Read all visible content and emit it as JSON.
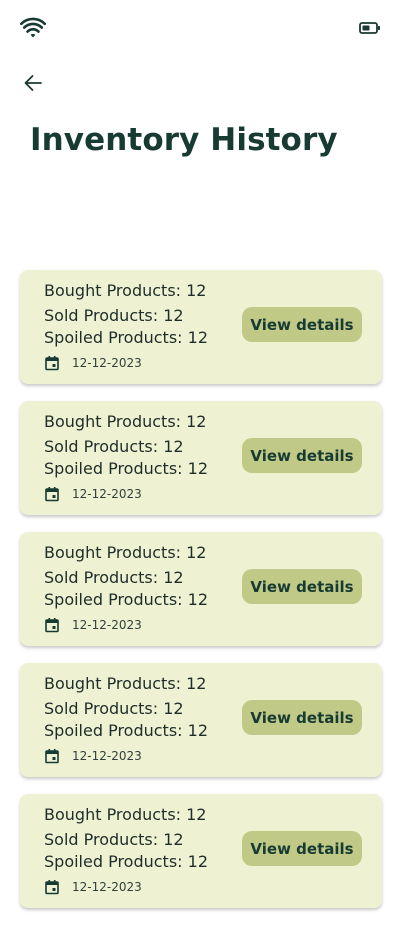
{
  "status_bar": {
    "wifi_icon": "wifi-icon",
    "battery_icon": "battery-icon"
  },
  "header": {
    "back_icon": "arrow-left-icon",
    "title": "Inventory History"
  },
  "colors": {
    "card_background": "#eff2d2",
    "button_background": "#c0c986",
    "title_color": "#173a33"
  },
  "history": [
    {
      "bought": "Bought Products: 12",
      "sold": "Sold Products: 12",
      "spoiled": "Spoiled Products: 12",
      "date": "12-12-2023",
      "button": "View details"
    },
    {
      "bought": "Bought Products: 12",
      "sold": "Sold Products: 12",
      "spoiled": "Spoiled Products: 12",
      "date": "12-12-2023",
      "button": "View details"
    },
    {
      "bought": "Bought Products: 12",
      "sold": "Sold Products: 12",
      "spoiled": "Spoiled Products: 12",
      "date": "12-12-2023",
      "button": "View details"
    },
    {
      "bought": "Bought Products: 12",
      "sold": "Sold Products: 12",
      "spoiled": "Spoiled Products: 12",
      "date": "12-12-2023",
      "button": "View details"
    },
    {
      "bought": "Bought Products: 12",
      "sold": "Sold Products: 12",
      "spoiled": "Spoiled Products: 12",
      "date": "12-12-2023",
      "button": "View details"
    }
  ]
}
